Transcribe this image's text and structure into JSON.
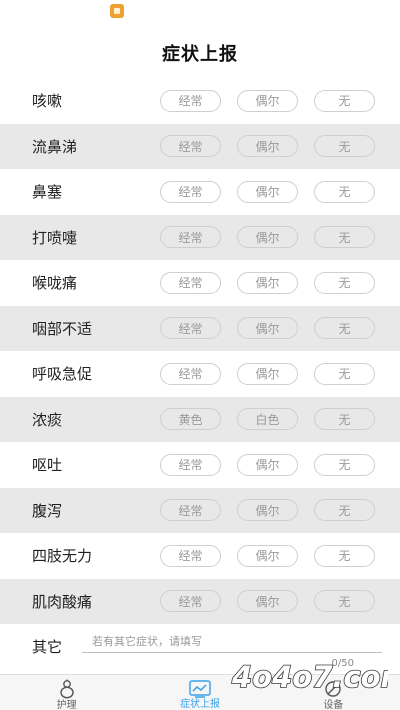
{
  "header": {
    "title": "症状上报"
  },
  "symptoms": [
    {
      "label": "咳嗽",
      "options": [
        "经常",
        "偶尔",
        "无"
      ]
    },
    {
      "label": "流鼻涕",
      "options": [
        "经常",
        "偶尔",
        "无"
      ]
    },
    {
      "label": "鼻塞",
      "options": [
        "经常",
        "偶尔",
        "无"
      ]
    },
    {
      "label": "打喷嚏",
      "options": [
        "经常",
        "偶尔",
        "无"
      ]
    },
    {
      "label": "喉咙痛",
      "options": [
        "经常",
        "偶尔",
        "无"
      ]
    },
    {
      "label": "咽部不适",
      "options": [
        "经常",
        "偶尔",
        "无"
      ]
    },
    {
      "label": "呼吸急促",
      "options": [
        "经常",
        "偶尔",
        "无"
      ]
    },
    {
      "label": "浓痰",
      "options": [
        "黄色",
        "白色",
        "无"
      ]
    },
    {
      "label": "呕吐",
      "options": [
        "经常",
        "偶尔",
        "无"
      ]
    },
    {
      "label": "腹泻",
      "options": [
        "经常",
        "偶尔",
        "无"
      ]
    },
    {
      "label": "四肢无力",
      "options": [
        "经常",
        "偶尔",
        "无"
      ]
    },
    {
      "label": "肌肉酸痛",
      "options": [
        "经常",
        "偶尔",
        "无"
      ]
    }
  ],
  "other": {
    "label": "其它",
    "placeholder": "若有其它症状，请填写",
    "count": "0/50"
  },
  "tabs": [
    {
      "label": "护理",
      "icon": "gourd-icon",
      "active": false
    },
    {
      "label": "症状上报",
      "icon": "report-chart-icon",
      "active": true
    },
    {
      "label": "设备",
      "icon": "device-icon",
      "active": false
    }
  ],
  "watermark": {
    "text": "4o4o7.com"
  },
  "colors": {
    "accent": "#3aa0e8",
    "stripe": "#e8e8e8",
    "badge": "#f0a030"
  }
}
